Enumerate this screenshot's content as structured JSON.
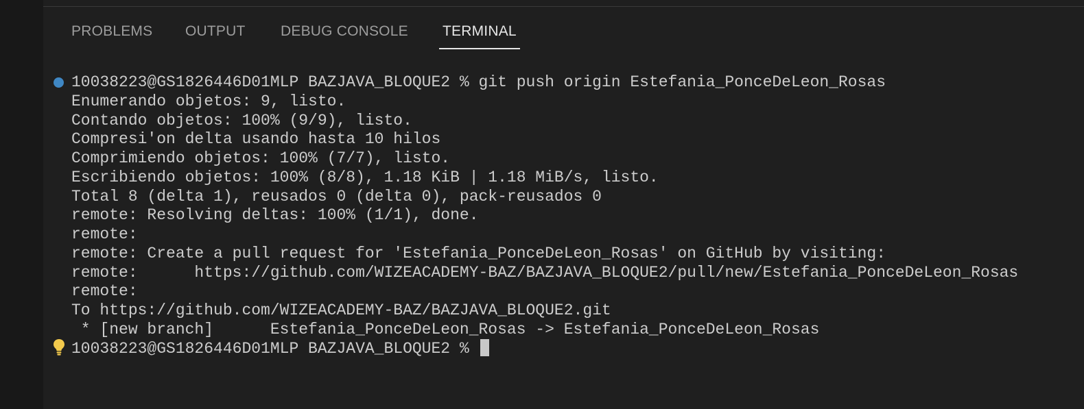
{
  "panel": {
    "tabs": [
      {
        "label": "PROBLEMS",
        "active": false
      },
      {
        "label": "OUTPUT",
        "active": false
      },
      {
        "label": "DEBUG CONSOLE",
        "active": false
      },
      {
        "label": "TERMINAL",
        "active": true
      }
    ]
  },
  "terminal": {
    "command_prompt": "10038223@GS1826446D01MLP BAZJAVA_BLOQUE2 % ",
    "command": "git push origin Estefania_PonceDeLeon_Rosas",
    "output": [
      "Enumerando objetos: 9, listo.",
      "Contando objetos: 100% (9/9), listo.",
      "Compresi'on delta usando hasta 10 hilos",
      "Comprimiendo objetos: 100% (7/7), listo.",
      "Escribiendo objetos: 100% (8/8), 1.18 KiB | 1.18 MiB/s, listo.",
      "Total 8 (delta 1), reusados 0 (delta 0), pack-reusados 0",
      "remote: Resolving deltas: 100% (1/1), done.",
      "remote:",
      "remote: Create a pull request for 'Estefania_PonceDeLeon_Rosas' on GitHub by visiting:",
      "remote:      https://github.com/WIZEACADEMY-BAZ/BAZJAVA_BLOQUE2/pull/new/Estefania_PonceDeLeon_Rosas",
      "remote:",
      "To https://github.com/WIZEACADEMY-BAZ/BAZJAVA_BLOQUE2.git",
      " * [new branch]      Estefania_PonceDeLeon_Rosas -> Estefania_PonceDeLeon_Rosas"
    ],
    "current_prompt": "10038223@GS1826446D01MLP BAZJAVA_BLOQUE2 % ",
    "gutter_icons": [
      "command-status-dot-icon",
      "lightbulb-icon"
    ],
    "colors": {
      "status_dot": "#3f87c4",
      "lightbulb": "#f2c94c",
      "text": "#cccccc",
      "background": "#1f1f1f"
    }
  }
}
